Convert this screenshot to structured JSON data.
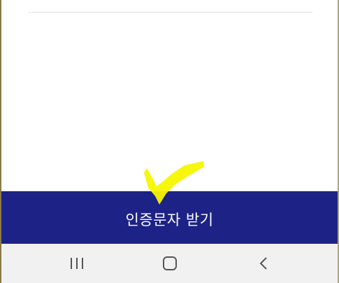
{
  "screen": {
    "cta_button": {
      "label": "인증문자 받기",
      "background": "#1d2287",
      "text_color": "#ffffff"
    },
    "annotation": {
      "icon": "checkmark-icon",
      "color": "#f7f500"
    }
  },
  "navbar": {
    "background": "#f1f1f1",
    "recent_icon": "recent-apps-icon",
    "home_icon": "home-icon",
    "back_icon": "back-icon"
  }
}
